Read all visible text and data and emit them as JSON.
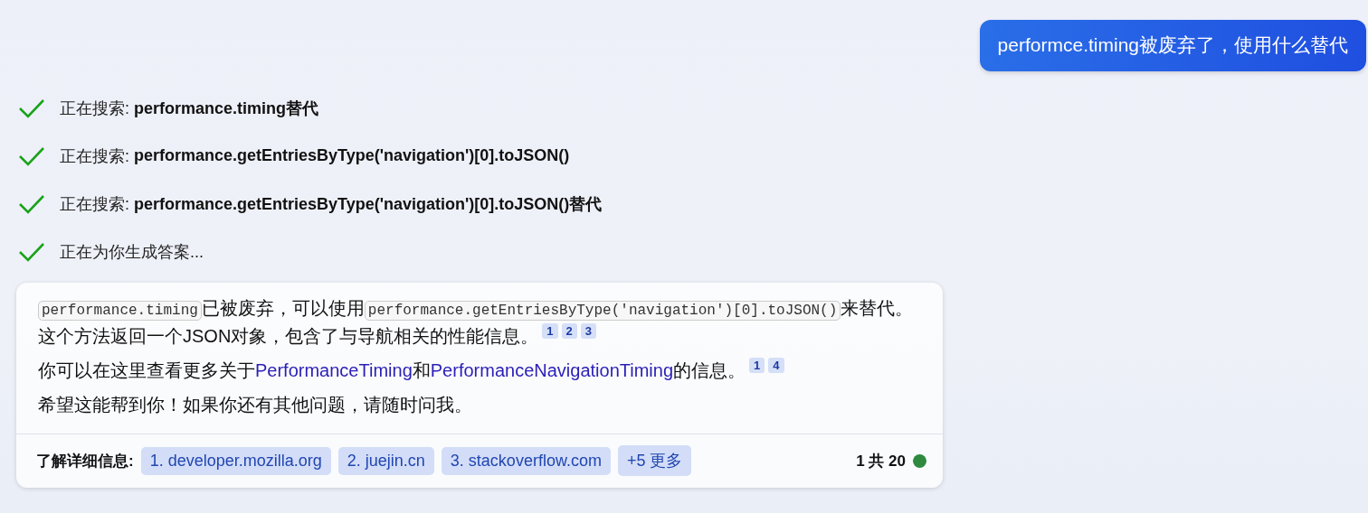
{
  "user_message": {
    "text": "performce.timing被废弃了，使用什么替代"
  },
  "steps": [
    {
      "label": "正在搜索:",
      "query": "performance.timing替代",
      "done": true
    },
    {
      "label": "正在搜索:",
      "query": "performance.getEntriesByType('navigation')[0].toJSON()",
      "done": true
    },
    {
      "label": "正在搜索:",
      "query": "performance.getEntriesByType('navigation')[0].toJSON()替代",
      "done": true
    },
    {
      "label": "正在为你生成答案...",
      "done": true
    }
  ],
  "answer": {
    "paragraphs": [
      [
        {
          "kind": "code",
          "text": "performance.timing"
        },
        {
          "kind": "text",
          "text": "已被废弃，可以使用"
        },
        {
          "kind": "code",
          "text": "performance.getEntriesByType('navigation')[0].toJSON()"
        },
        {
          "kind": "text",
          "text": "来替代。这个方法返回一个JSON对象，包含了与导航相关的性能信息。"
        },
        {
          "kind": "citation",
          "text": "1"
        },
        {
          "kind": "citation",
          "text": "2"
        },
        {
          "kind": "citation",
          "text": "3"
        }
      ],
      [
        {
          "kind": "text",
          "text": "你可以在这里查看更多关于"
        },
        {
          "kind": "link",
          "text": "PerformanceTiming"
        },
        {
          "kind": "text",
          "text": "和"
        },
        {
          "kind": "link",
          "text": "PerformanceNavigationTiming"
        },
        {
          "kind": "text",
          "text": "的信息。"
        },
        {
          "kind": "citation",
          "text": "1"
        },
        {
          "kind": "citation",
          "text": "4"
        }
      ],
      [
        {
          "kind": "text",
          "text": "希望这能帮到你！如果你还有其他问题，请随时问我。"
        }
      ]
    ],
    "footer": {
      "label": "了解详细信息:",
      "sources": [
        "1. developer.mozilla.org",
        "2. juejin.cn",
        "3. stackoverflow.com",
        "+5 更多"
      ],
      "counter": "1 共 20"
    }
  }
}
